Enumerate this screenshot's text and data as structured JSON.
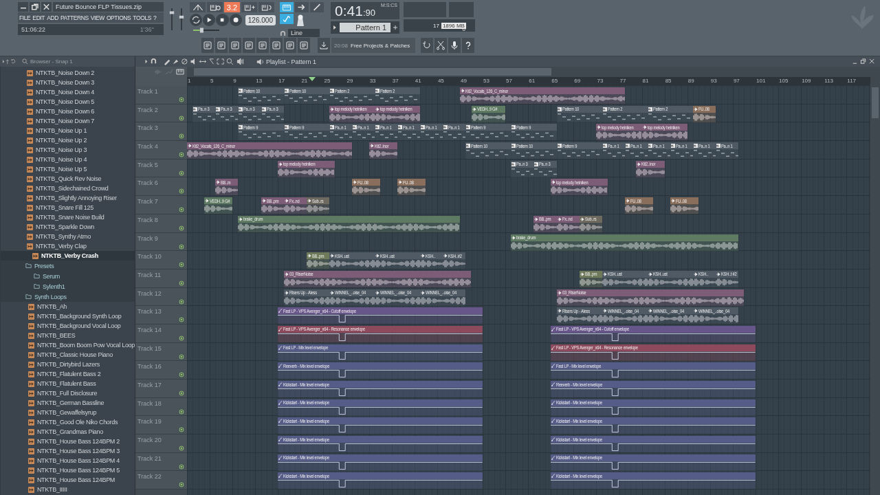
{
  "window": {
    "title": "Future Bounce FLP Tissues.zip"
  },
  "menu": [
    "FILE",
    "EDIT",
    "ADD",
    "PATTERNS",
    "VIEW",
    "OPTIONS",
    "TOOLS",
    "?"
  ],
  "hint_panel": {
    "left": "51:06:22",
    "right": "1'36''"
  },
  "transport": {
    "mode_display": {
      "text": "3.2",
      "on": true
    },
    "tempo": "126.000",
    "time": "0:41",
    "time_fraction": ":90",
    "time_unit": "M:S:CS",
    "pattern": "Pattern 1",
    "snap": "Line"
  },
  "master_volume": {
    "level": 0.8
  },
  "master_pitch": {
    "level": 0.6
  },
  "tempo_nudge": {
    "level": 0.3
  },
  "tools": [
    {
      "kind": "keyboard",
      "on": true
    },
    {
      "kind": "arrow",
      "on": false
    },
    {
      "kind": "brush",
      "on": false
    },
    {
      "kind": "link",
      "on": true
    }
  ],
  "monitor": {
    "cpu": "17",
    "memory": "1896 MB",
    "polyphony": "0"
  },
  "news": {
    "time": "20:08",
    "text": "Free Projects & Patches"
  },
  "browser": {
    "title": "Browser - Snap 1",
    "tree": [
      {
        "kind": "file",
        "name": "NTKTB_Noise Down 2",
        "selected": false
      },
      {
        "kind": "file",
        "name": "NTKTB_Noise Down 3",
        "selected": false
      },
      {
        "kind": "file",
        "name": "NTKTB_Noise Down 4",
        "selected": false
      },
      {
        "kind": "file",
        "name": "NTKTB_Noise Down 5",
        "selected": false
      },
      {
        "kind": "file",
        "name": "NTKTB_Noise Down 6",
        "selected": false
      },
      {
        "kind": "file",
        "name": "NTKTB_Noise Down 7",
        "selected": false
      },
      {
        "kind": "file",
        "name": "NTKTB_Noise Up 1",
        "selected": false
      },
      {
        "kind": "file",
        "name": "NTKTB_Noise Up 2",
        "selected": false
      },
      {
        "kind": "file",
        "name": "NTKTB_Noise Up 3",
        "selected": false
      },
      {
        "kind": "file",
        "name": "NTKTB_Noise Up 4",
        "selected": false
      },
      {
        "kind": "file",
        "name": "NTKTB_Noise Up 5",
        "selected": false
      },
      {
        "kind": "file",
        "name": "NTKTB_Quick Rev Noise",
        "selected": false
      },
      {
        "kind": "file",
        "name": "NTKTB_Sidechained Crowd",
        "selected": false
      },
      {
        "kind": "file",
        "name": "NTKTB_Slightly Annoying Riser",
        "selected": false
      },
      {
        "kind": "file",
        "name": "NTKTB_Snare Fill 125",
        "selected": false
      },
      {
        "kind": "file",
        "name": "NTKTB_Snare Noise Build",
        "selected": false
      },
      {
        "kind": "file",
        "name": "NTKTB_Sparkle Down",
        "selected": false
      },
      {
        "kind": "file",
        "name": "NTKTB_Synthy Atmo",
        "selected": false
      },
      {
        "kind": "file",
        "name": "NTKTB_Verby Clap",
        "selected": false
      },
      {
        "kind": "file",
        "name": "NTKTB_Verby Crash",
        "selected": true
      },
      {
        "kind": "folder",
        "name": "Presets",
        "children": [
          {
            "kind": "folder",
            "name": "Serum"
          },
          {
            "kind": "folder",
            "name": "Sylenth1"
          }
        ]
      },
      {
        "kind": "folder",
        "name": "Synth Loops",
        "children": [
          {
            "kind": "file",
            "name": "NTKTB_Ah",
            "selected": false
          },
          {
            "kind": "file",
            "name": "NTKTB_Background Synth Loop",
            "selected": false
          },
          {
            "kind": "file",
            "name": "NTKTB_Background Vocal Loop",
            "selected": false
          },
          {
            "kind": "file",
            "name": "NTKTB_BEES",
            "selected": false
          },
          {
            "kind": "file",
            "name": "NTKTB_Boom Boom Pow Vocal Loop",
            "selected": false
          },
          {
            "kind": "file",
            "name": "NTKTB_Classic House Piano",
            "selected": false
          },
          {
            "kind": "file",
            "name": "NTKTB_Dirtybird Lazers",
            "selected": false
          },
          {
            "kind": "file",
            "name": "NTKTB_Flatulent Bass 2",
            "selected": false
          },
          {
            "kind": "file",
            "name": "NTKTB_Flatulent Bass",
            "selected": false
          },
          {
            "kind": "file",
            "name": "NTKTB_Full Disclosure",
            "selected": false
          },
          {
            "kind": "file",
            "name": "NTKTB_German Bassline",
            "selected": false
          },
          {
            "kind": "file",
            "name": "NTKTB_Gewaffelsyrup",
            "selected": false
          },
          {
            "kind": "file",
            "name": "NTKTB_Good Ole Niko Chords",
            "selected": false
          },
          {
            "kind": "file",
            "name": "NTKTB_Grandmas Piano",
            "selected": false
          },
          {
            "kind": "file",
            "name": "NTKTB_House Bass 124BPM 2",
            "selected": false
          },
          {
            "kind": "file",
            "name": "NTKTB_House Bass 124BPM 3",
            "selected": false
          },
          {
            "kind": "file",
            "name": "NTKTB_House Bass 124BPM 4",
            "selected": false
          },
          {
            "kind": "file",
            "name": "NTKTB_House Bass 124BPM 5",
            "selected": false
          },
          {
            "kind": "file",
            "name": "NTKTB_House Bass 124BPM",
            "selected": false
          },
          {
            "kind": "file",
            "name": "NTKTB_IIIII",
            "selected": false
          }
        ]
      }
    ]
  },
  "playlist": {
    "title": "Playlist - Pattern 1",
    "ruler": [
      "1",
      "5",
      "9",
      "13",
      "17",
      "21",
      "25",
      "29",
      "33",
      "37",
      "41",
      "45",
      "49",
      "53",
      "57",
      "61",
      "65",
      "69",
      "73",
      "77",
      "81",
      "85",
      "89",
      "93",
      "97",
      "101",
      "105",
      "109",
      "113",
      "117"
    ],
    "tracks": [
      {
        "label": "Track 1",
        "clips": [
          {
            "kind": "pattern",
            "label": "Pattern 10",
            "color": "#4f5a64"
          },
          {
            "kind": "pattern",
            "label": "Pattern 10",
            "color": "#4f5a64"
          },
          {
            "kind": "pattern",
            "label": "Pattern 2",
            "color": "#4f5a64"
          },
          {
            "kind": "pattern",
            "label": "Pattern 2",
            "color": "#4f5a64"
          },
          {
            "kind": "audio",
            "label": "Kit2_Vocals_126_C_minor",
            "color": "#7d5c77"
          }
        ]
      },
      {
        "label": "Track 2",
        "clips": [
          {
            "kind": "pattern",
            "label": "Pa..n 3",
            "color": "#4f5a64"
          },
          {
            "kind": "pattern",
            "label": "Pa..n 3",
            "color": "#4f5a64"
          },
          {
            "kind": "pattern",
            "label": "Pa..n 3",
            "color": "#4f5a64"
          },
          {
            "kind": "pattern",
            "label": "Pa..n 3",
            "color": "#4f5a64"
          },
          {
            "kind": "audio",
            "label": "top melody heiniken",
            "color": "#7d5c77"
          },
          {
            "kind": "audio",
            "label": "top melody heiniken",
            "color": "#7d5c77"
          },
          {
            "kind": "audio",
            "label": "VEDH..9 G#",
            "color": "#5e7a62"
          },
          {
            "kind": "pattern",
            "label": "Pattern 10",
            "color": "#4f5a64"
          },
          {
            "kind": "pattern",
            "label": "Pattern 2",
            "color": "#4f5a64"
          },
          {
            "kind": "pattern",
            "label": "Pattern 2",
            "color": "#4f5a64"
          },
          {
            "kind": "audio",
            "label": "FU..08",
            "color": "#8a6e5c"
          }
        ]
      },
      {
        "label": "Track 3",
        "clips": [
          {
            "kind": "pattern",
            "label": "Pattern 9",
            "color": "#4f5a64"
          },
          {
            "kind": "pattern",
            "label": "Pattern 9",
            "color": "#4f5a64"
          },
          {
            "kind": "pattern",
            "label": "Pa..n 1",
            "color": "#4f5a64"
          },
          {
            "kind": "pattern",
            "label": "Pa..n 1",
            "color": "#4f5a64"
          },
          {
            "kind": "pattern",
            "label": "Pa..n 1",
            "color": "#4f5a64"
          },
          {
            "kind": "pattern",
            "label": "Pa..n 1",
            "color": "#4f5a64"
          },
          {
            "kind": "pattern",
            "label": "Pa..n 1",
            "color": "#4f5a64"
          },
          {
            "kind": "pattern",
            "label": "Pa..n 1",
            "color": "#4f5a64"
          },
          {
            "kind": "pattern",
            "label": "Pattern 9",
            "color": "#4f5a64"
          },
          {
            "kind": "pattern",
            "label": "Pattern 9",
            "color": "#4f5a64"
          },
          {
            "kind": "audio",
            "label": "top melody heiniken",
            "color": "#7d5c77"
          },
          {
            "kind": "audio",
            "label": "top melody heiniken",
            "color": "#7d5c77"
          }
        ]
      },
      {
        "label": "Track 4",
        "clips": [
          {
            "kind": "audio",
            "label": "Kit2_Vocals_126_C_minor",
            "color": "#7d5c77"
          },
          {
            "kind": "audio",
            "label": "Kit2..inor",
            "color": "#7d5c77"
          },
          {
            "kind": "pattern",
            "label": "Pattern 10",
            "color": "#4f5a64"
          },
          {
            "kind": "pattern",
            "label": "Pattern 10",
            "color": "#4f5a64"
          },
          {
            "kind": "pattern",
            "label": "Pattern 9",
            "color": "#4f5a64"
          },
          {
            "kind": "pattern",
            "label": "Pa..n 1",
            "color": "#4f5a64"
          },
          {
            "kind": "pattern",
            "label": "Pa..n 1",
            "color": "#4f5a64"
          },
          {
            "kind": "pattern",
            "label": "Pa..n 1",
            "color": "#4f5a64"
          },
          {
            "kind": "pattern",
            "label": "Pa..n 1",
            "color": "#4f5a64"
          },
          {
            "kind": "pattern",
            "label": "Pa..n 1",
            "color": "#4f5a64"
          },
          {
            "kind": "pattern",
            "label": "Pa..n 1",
            "color": "#4f5a64"
          }
        ]
      },
      {
        "label": "Track 5",
        "clips": [
          {
            "kind": "audio",
            "label": "top melody heiniken",
            "color": "#7d5c77"
          },
          {
            "kind": "pattern",
            "label": "Pa..n 3",
            "color": "#4f5a64"
          },
          {
            "kind": "pattern",
            "label": "Pa..n 3",
            "color": "#4f5a64"
          },
          {
            "kind": "audio",
            "label": "Kit2..inor",
            "color": "#7d5c77"
          }
        ]
      },
      {
        "label": "Track 6",
        "clips": [
          {
            "kind": "audio",
            "label": "BB..m",
            "color": "#7d5c77"
          },
          {
            "kind": "audio",
            "label": "FU..08",
            "color": "#8a6e5c"
          },
          {
            "kind": "audio",
            "label": "FU..08",
            "color": "#8a6e5c"
          },
          {
            "kind": "audio",
            "label": "top melody heiniken",
            "color": "#7d5c77"
          }
        ]
      },
      {
        "label": "Track 7",
        "clips": [
          {
            "kind": "audio",
            "label": "VEDH..9 G#",
            "color": "#5e7a62"
          },
          {
            "kind": "audio",
            "label": "BB..pm",
            "color": "#7d5c77"
          },
          {
            "kind": "audio",
            "label": "Fx..nd",
            "color": "#7d5c77"
          },
          {
            "kind": "audio",
            "label": "Sub..rs",
            "color": "#6e6a60"
          },
          {
            "kind": "audio",
            "label": "FU..08",
            "color": "#8a6e5c"
          },
          {
            "kind": "audio",
            "label": "FU..08",
            "color": "#8a6e5c"
          }
        ]
      },
      {
        "label": "Track 8",
        "clips": [
          {
            "kind": "audio",
            "label": "brake_drum",
            "color": "#5e7a62"
          },
          {
            "kind": "audio",
            "label": "BB..pm",
            "color": "#7d5c77"
          },
          {
            "kind": "audio",
            "label": "Fx..nd",
            "color": "#7d5c77"
          },
          {
            "kind": "audio",
            "label": "Sub..rs",
            "color": "#6e6a60"
          }
        ]
      },
      {
        "label": "Track 9",
        "clips": [
          {
            "kind": "audio",
            "label": "brake_drum",
            "color": "#5e7a62"
          }
        ]
      },
      {
        "label": "Track 10",
        "clips": [
          {
            "kind": "audio",
            "label": "BB..pm",
            "color": "#6e7a5a"
          },
          {
            "kind": "audio",
            "label": "KSH..ust",
            "color": "#4f5a64"
          },
          {
            "kind": "audio",
            "label": "KSH..ust",
            "color": "#4f5a64"
          },
          {
            "kind": "audio",
            "label": "KSH..",
            "color": "#4f5a64"
          },
          {
            "kind": "audio",
            "label": "KSH..#2",
            "color": "#4f5a64"
          }
        ]
      },
      {
        "label": "Track 11",
        "clips": [
          {
            "kind": "audio",
            "label": "03_RiserNoise",
            "color": "#7d5c77"
          },
          {
            "kind": "audio",
            "label": "BB..pm",
            "color": "#6e7a5a"
          },
          {
            "kind": "audio",
            "label": "KSH..ust",
            "color": "#4f5a64"
          },
          {
            "kind": "audio",
            "label": "KSH..ust",
            "color": "#4f5a64"
          },
          {
            "kind": "audio",
            "label": "KSH..",
            "color": "#4f5a64"
          },
          {
            "kind": "audio",
            "label": "KSH..t #2",
            "color": "#4f5a64"
          }
        ]
      },
      {
        "label": "Track 12",
        "clips": [
          {
            "kind": "audio",
            "label": "Risers Up - Aless",
            "color": "#4f5a64"
          },
          {
            "kind": "audio",
            "label": "WINNEL_..oise_04",
            "color": "#4f5a64"
          },
          {
            "kind": "audio",
            "label": "WINNEL_..oise_04",
            "color": "#4f5a64"
          },
          {
            "kind": "audio",
            "label": "WINNEL_..oise_04",
            "color": "#4f5a64"
          },
          {
            "kind": "audio",
            "label": "03_RiserNoise",
            "color": "#7d5c77"
          }
        ]
      },
      {
        "label": "Track 13",
        "clips": [
          {
            "kind": "automation",
            "label": "Fast LP - VPS Avenger_x64 - Cutoff envelope",
            "color": "#67568a"
          },
          {
            "kind": "audio",
            "label": "Risers Up - Aless",
            "color": "#4f5a64"
          },
          {
            "kind": "audio",
            "label": "WINNEL_..oise_04",
            "color": "#4f5a64"
          },
          {
            "kind": "audio",
            "label": "WINNEL_..oise_04",
            "color": "#4f5a64"
          },
          {
            "kind": "audio",
            "label": "WINNEL_..oise_04",
            "color": "#4f5a64"
          }
        ]
      },
      {
        "label": "Track 14",
        "clips": [
          {
            "kind": "automation",
            "label": "Fast LP - VPS Avenger_x64 - Resonance envelope",
            "color": "#8c4a5c"
          },
          {
            "kind": "automation",
            "label": "Fast LP - VPS Avenger_x64 - Cutoff envelope",
            "color": "#67568a"
          }
        ]
      },
      {
        "label": "Track 15",
        "clips": [
          {
            "kind": "automation",
            "label": "Fast LP - Mix level envelope",
            "color": "#565c88"
          },
          {
            "kind": "automation",
            "label": "Fast LP - VPS Avenger_x64 - Resonance envelope",
            "color": "#8c4a5c"
          }
        ]
      },
      {
        "label": "Track 16",
        "clips": [
          {
            "kind": "automation",
            "label": "Reeverb - Mix level envelope",
            "color": "#565c88"
          },
          {
            "kind": "automation",
            "label": "Fast LP - Mix level envelope",
            "color": "#565c88"
          }
        ]
      },
      {
        "label": "Track 17",
        "clips": [
          {
            "kind": "automation",
            "label": "Kickstart - Mix level envelope",
            "color": "#565c88"
          },
          {
            "kind": "automation",
            "label": "Reeverb - Mix level envelope",
            "color": "#565c88"
          }
        ]
      },
      {
        "label": "Track 18",
        "clips": [
          {
            "kind": "automation",
            "label": "Kickstart - Mix level envelope",
            "color": "#565c88"
          },
          {
            "kind": "automation",
            "label": "Kickstart - Mix level envelope",
            "color": "#565c88"
          }
        ]
      },
      {
        "label": "Track 19",
        "clips": [
          {
            "kind": "automation",
            "label": "Kickstart - Mix level envelope",
            "color": "#565c88"
          },
          {
            "kind": "automation",
            "label": "Kickstart - Mix level envelope",
            "color": "#565c88"
          }
        ]
      },
      {
        "label": "Track 20",
        "clips": [
          {
            "kind": "automation",
            "label": "Kickstart - Mix level envelope",
            "color": "#565c88"
          },
          {
            "kind": "automation",
            "label": "Kickstart - Mix level envelope",
            "color": "#565c88"
          }
        ]
      },
      {
        "label": "Track 21",
        "clips": [
          {
            "kind": "automation",
            "label": "Kickstart - Mix level envelope",
            "color": "#565c88"
          },
          {
            "kind": "automation",
            "label": "Kickstart - Mix level envelope",
            "color": "#565c88"
          }
        ]
      },
      {
        "label": "Track 22",
        "clips": [
          {
            "kind": "automation",
            "label": "Kickstart - Mix level envelope",
            "color": "#565c88"
          },
          {
            "kind": "automation",
            "label": "Kickstart - Mix level envelope",
            "color": "#565c88"
          }
        ]
      }
    ]
  }
}
